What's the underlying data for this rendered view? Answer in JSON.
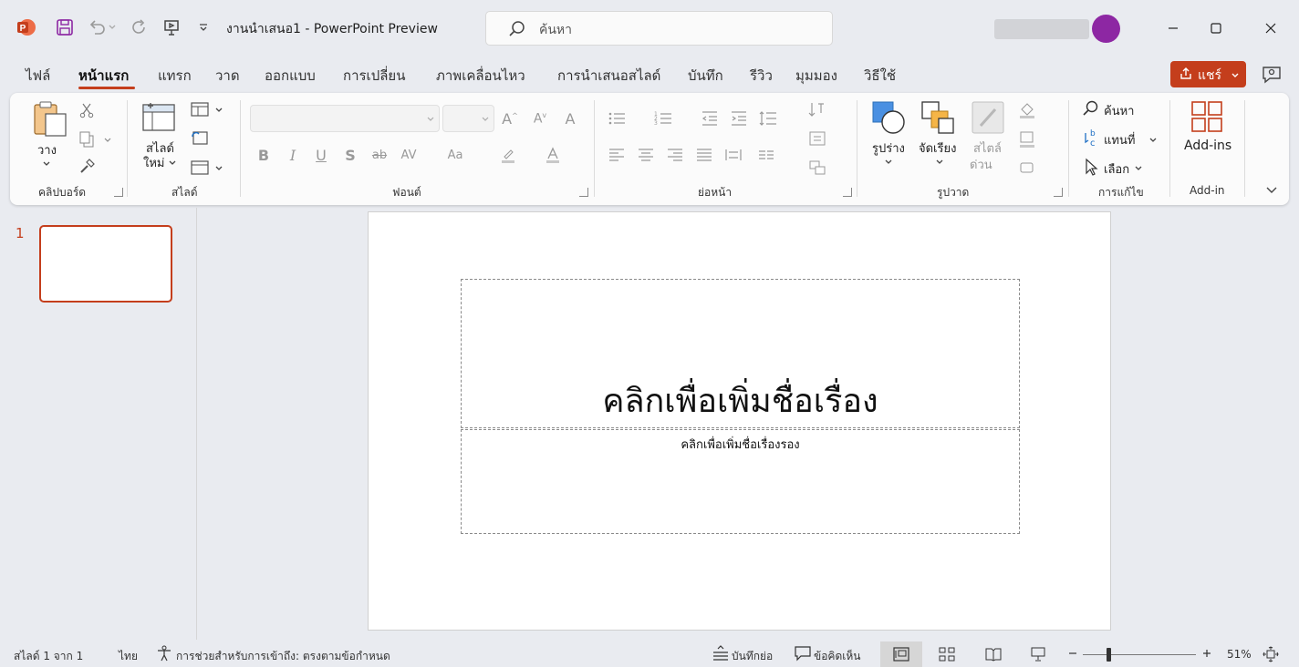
{
  "app": {
    "title": "งานนำเสนอ1  -  PowerPoint Preview",
    "logo_icon": "powerpoint-logo-icon",
    "accent": "#c43e1c",
    "avatar_color": "#8d27a3"
  },
  "search": {
    "placeholder": "ค้นหา"
  },
  "tabs": [
    {
      "label": "ไฟล์"
    },
    {
      "label": "หน้าแรก"
    },
    {
      "label": "แทรก"
    },
    {
      "label": "วาด"
    },
    {
      "label": "ออกแบบ"
    },
    {
      "label": "การเปลี่ยน"
    },
    {
      "label": "ภาพเคลื่อนไหว"
    },
    {
      "label": "การนำเสนอสไลด์"
    },
    {
      "label": "บันทึก"
    },
    {
      "label": "รีวิว"
    },
    {
      "label": "มุมมอง"
    },
    {
      "label": "วิธีใช้"
    }
  ],
  "active_tab": "หน้าแรก",
  "share": {
    "label": "แชร์"
  },
  "ribbon": {
    "clipboard": {
      "paste": "วาง",
      "group": "คลิปบอร์ด"
    },
    "slides": {
      "new_slide_1": "สไลด์",
      "new_slide_2": "ใหม่",
      "group": "สไลด์"
    },
    "font": {
      "group": "ฟอนต์"
    },
    "paragraph": {
      "group": "ย่อหน้า"
    },
    "drawing": {
      "shapes": "รูปร่าง",
      "arrange": "จัดเรียง",
      "quick_styles_1": "สไตล์",
      "quick_styles_2": "ด่วน",
      "group": "รูปวาด"
    },
    "editing": {
      "find": "ค้นหา",
      "replace": "แทนที่",
      "select": "เลือก",
      "group": "การแก้ไข"
    },
    "addins": {
      "label": "Add-ins",
      "group": "Add-in"
    }
  },
  "thumbnail": {
    "number": "1"
  },
  "slide": {
    "title_placeholder": "คลิกเพื่อเพิ่มชื่อเรื่อง",
    "subtitle_placeholder": "คลิกเพื่อเพิ่มชื่อเรื่องรอง"
  },
  "statusbar": {
    "slide_info": "สไลด์  1 จาก 1",
    "language": "ไทย",
    "accessibility": "การช่วยสำหรับการเข้าถึง: ตรงตามข้อกำหนด",
    "notes": "บันทึกย่อ",
    "comments": "ข้อคิดเห็น",
    "zoom": "51%",
    "zoom_level": 0.51
  }
}
